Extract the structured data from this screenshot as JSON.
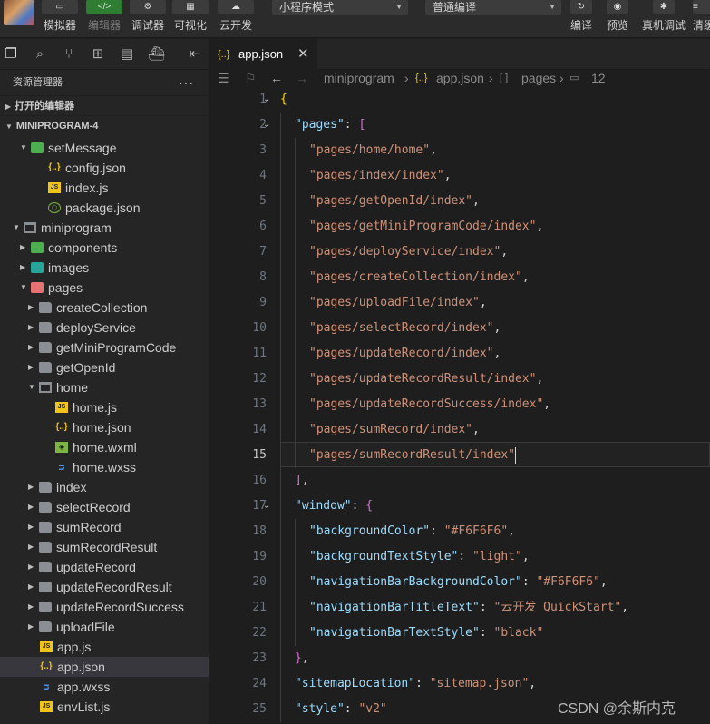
{
  "toolbar": {
    "buttons": [
      {
        "label": "模拟器",
        "icon": "phone-icon"
      },
      {
        "label": "编辑器",
        "icon": "code-icon"
      },
      {
        "label": "调试器",
        "icon": "debug-icon"
      },
      {
        "label": "可视化",
        "icon": "layout-icon"
      },
      {
        "label": "云开发",
        "icon": "cloud-icon"
      }
    ],
    "mode_select": "小程序模式",
    "compile_select": "普通编译",
    "actions": [
      {
        "label": "编译",
        "icon": "refresh-icon"
      },
      {
        "label": "预览",
        "icon": "eye-icon"
      },
      {
        "label": "真机调试",
        "icon": "bug-icon"
      },
      {
        "label": "清缓",
        "icon": "layers-icon"
      }
    ]
  },
  "sidebar": {
    "title": "资源管理器",
    "more": "···",
    "open_editors": "打开的编辑器",
    "project": "MINIPROGRAM-4",
    "tree": [
      {
        "name": "setMessage",
        "type": "folder-green",
        "indent": 1,
        "expanded": true
      },
      {
        "name": "config.json",
        "type": "json",
        "indent": 2
      },
      {
        "name": "index.js",
        "type": "js",
        "indent": 2
      },
      {
        "name": "package.json",
        "type": "pkg",
        "indent": 2
      },
      {
        "name": "miniprogram",
        "type": "folder-open",
        "indent": 0,
        "expanded": true
      },
      {
        "name": "components",
        "type": "folder-green",
        "indent": 1,
        "expanded": false
      },
      {
        "name": "images",
        "type": "folder-teal",
        "indent": 1,
        "expanded": false
      },
      {
        "name": "pages",
        "type": "folder-red",
        "indent": 1,
        "expanded": true
      },
      {
        "name": "createCollection",
        "type": "folder",
        "indent": 2,
        "expanded": false
      },
      {
        "name": "deployService",
        "type": "folder",
        "indent": 2,
        "expanded": false
      },
      {
        "name": "getMiniProgramCode",
        "type": "folder",
        "indent": 2,
        "expanded": false
      },
      {
        "name": "getOpenId",
        "type": "folder",
        "indent": 2,
        "expanded": false
      },
      {
        "name": "home",
        "type": "folder-open",
        "indent": 2,
        "expanded": true
      },
      {
        "name": "home.js",
        "type": "js",
        "indent": 3
      },
      {
        "name": "home.json",
        "type": "json",
        "indent": 3
      },
      {
        "name": "home.wxml",
        "type": "wxml",
        "indent": 3
      },
      {
        "name": "home.wxss",
        "type": "wxss",
        "indent": 3
      },
      {
        "name": "index",
        "type": "folder",
        "indent": 2,
        "expanded": false
      },
      {
        "name": "selectRecord",
        "type": "folder",
        "indent": 2,
        "expanded": false
      },
      {
        "name": "sumRecord",
        "type": "folder",
        "indent": 2,
        "expanded": false
      },
      {
        "name": "sumRecordResult",
        "type": "folder",
        "indent": 2,
        "expanded": false
      },
      {
        "name": "updateRecord",
        "type": "folder",
        "indent": 2,
        "expanded": false
      },
      {
        "name": "updateRecordResult",
        "type": "folder",
        "indent": 2,
        "expanded": false
      },
      {
        "name": "updateRecordSuccess",
        "type": "folder",
        "indent": 2,
        "expanded": false
      },
      {
        "name": "uploadFile",
        "type": "folder",
        "indent": 2,
        "expanded": false
      },
      {
        "name": "app.js",
        "type": "js",
        "indent": 1
      },
      {
        "name": "app.json",
        "type": "json",
        "indent": 1,
        "active": true
      },
      {
        "name": "app.wxss",
        "type": "wxss",
        "indent": 1
      },
      {
        "name": "envList.js",
        "type": "js",
        "indent": 1
      }
    ]
  },
  "editor": {
    "tab": {
      "name": "app.json",
      "close": "✕"
    },
    "breadcrumb": {
      "root": "miniprogram",
      "file": "app.json",
      "key": "pages",
      "index": "12"
    },
    "current_line": 15,
    "lines": [
      {
        "n": "1",
        "fold": true,
        "indent": 0,
        "html": "<span class=\"b1\">{</span>"
      },
      {
        "n": "2",
        "fold": true,
        "indent": 1,
        "html": "<span class=\"k\">\"pages\"</span><span class=\"p\">: </span><span class=\"b2\">[</span>"
      },
      {
        "n": "3",
        "indent": 2,
        "html": "<span class=\"s\">\"pages/home/home\"</span><span class=\"p\">,</span>"
      },
      {
        "n": "4",
        "indent": 2,
        "html": "<span class=\"s\">\"pages/index/index\"</span><span class=\"p\">,</span>"
      },
      {
        "n": "5",
        "indent": 2,
        "html": "<span class=\"s\">\"pages/getOpenId/index\"</span><span class=\"p\">,</span>"
      },
      {
        "n": "6",
        "indent": 2,
        "html": "<span class=\"s\">\"pages/getMiniProgramCode/index\"</span><span class=\"p\">,</span>"
      },
      {
        "n": "7",
        "indent": 2,
        "html": "<span class=\"s\">\"pages/deployService/index\"</span><span class=\"p\">,</span>"
      },
      {
        "n": "8",
        "indent": 2,
        "html": "<span class=\"s\">\"pages/createCollection/index\"</span><span class=\"p\">,</span>"
      },
      {
        "n": "9",
        "indent": 2,
        "html": "<span class=\"s\">\"pages/uploadFile/index\"</span><span class=\"p\">,</span>"
      },
      {
        "n": "10",
        "indent": 2,
        "html": "<span class=\"s\">\"pages/selectRecord/index\"</span><span class=\"p\">,</span>"
      },
      {
        "n": "11",
        "indent": 2,
        "html": "<span class=\"s\">\"pages/updateRecord/index\"</span><span class=\"p\">,</span>"
      },
      {
        "n": "12",
        "indent": 2,
        "html": "<span class=\"s\">\"pages/updateRecordResult/index\"</span><span class=\"p\">,</span>"
      },
      {
        "n": "13",
        "indent": 2,
        "html": "<span class=\"s\">\"pages/updateRecordSuccess/index\"</span><span class=\"p\">,</span>"
      },
      {
        "n": "14",
        "indent": 2,
        "html": "<span class=\"s\">\"pages/sumRecord/index\"</span><span class=\"p\">,</span>"
      },
      {
        "n": "15",
        "indent": 2,
        "html": "<span class=\"s\">\"pages/sumRecordResult/index\"</span><span class=\"cursor\"></span>"
      },
      {
        "n": "16",
        "indent": 1,
        "html": "<span class=\"b2\">]</span><span class=\"p\">,</span>"
      },
      {
        "n": "17",
        "fold": true,
        "indent": 1,
        "html": "<span class=\"k\">\"window\"</span><span class=\"p\">: </span><span class=\"b2\">{</span>"
      },
      {
        "n": "18",
        "indent": 2,
        "html": "<span class=\"k\">\"backgroundColor\"</span><span class=\"p\">: </span><span class=\"s\">\"#F6F6F6\"</span><span class=\"p\">,</span>"
      },
      {
        "n": "19",
        "indent": 2,
        "html": "<span class=\"k\">\"backgroundTextStyle\"</span><span class=\"p\">: </span><span class=\"s\">\"light\"</span><span class=\"p\">,</span>"
      },
      {
        "n": "20",
        "indent": 2,
        "html": "<span class=\"k\">\"navigationBarBackgroundColor\"</span><span class=\"p\">: </span><span class=\"s\">\"#F6F6F6\"</span><span class=\"p\">,</span>"
      },
      {
        "n": "21",
        "indent": 2,
        "html": "<span class=\"k\">\"navigationBarTitleText\"</span><span class=\"p\">: </span><span class=\"s\">\"云开发 QuickStart\"</span><span class=\"p\">,</span>"
      },
      {
        "n": "22",
        "indent": 2,
        "html": "<span class=\"k\">\"navigationBarTextStyle\"</span><span class=\"p\">: </span><span class=\"s\">\"black\"</span>"
      },
      {
        "n": "23",
        "indent": 1,
        "html": "<span class=\"b2\">}</span><span class=\"p\">,</span>"
      },
      {
        "n": "24",
        "indent": 1,
        "html": "<span class=\"k\">\"sitemapLocation\"</span><span class=\"p\">: </span><span class=\"s\">\"sitemap.json\"</span><span class=\"p\">,</span>"
      },
      {
        "n": "25",
        "indent": 1,
        "html": "<span class=\"k\">\"style\"</span><span class=\"p\">: </span><span class=\"s\">\"v2\"</span>"
      }
    ]
  },
  "watermark": "CSDN @余斯内克"
}
